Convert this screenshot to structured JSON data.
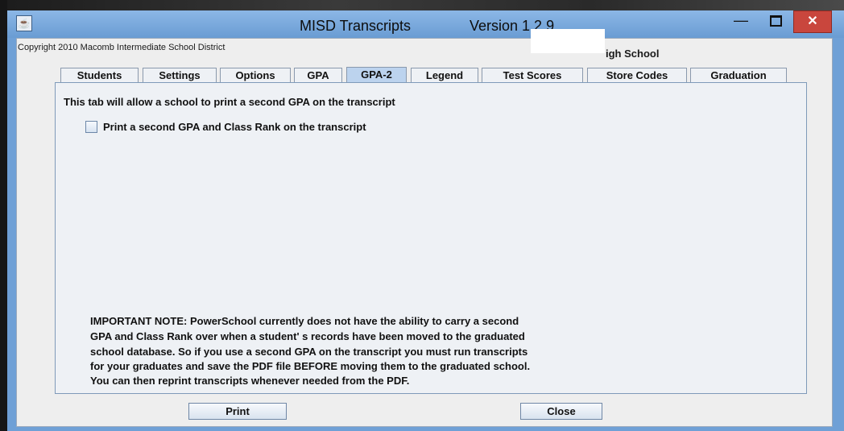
{
  "window": {
    "title": "MISD Transcripts",
    "version": "Version 1.2.9",
    "app_icon": "java-cup-icon",
    "controls": {
      "minimize": "—",
      "maximize": "maximize-icon",
      "close": "✕"
    }
  },
  "header": {
    "copyright": "Copyright 2010 Macomb Intermediate School District",
    "school_name": "igh School"
  },
  "tabs": [
    {
      "label": "Students"
    },
    {
      "label": "Settings"
    },
    {
      "label": "Options"
    },
    {
      "label": "GPA"
    },
    {
      "label": "GPA-2",
      "active": true
    },
    {
      "label": "Legend"
    },
    {
      "label": "Test Scores"
    },
    {
      "label": "Store Codes"
    },
    {
      "label": "Graduation"
    }
  ],
  "panel": {
    "intro": "This tab will allow a school to print a second GPA on the transcript",
    "checkbox": {
      "label": "Print a second GPA and Class Rank on the transcript",
      "checked": false
    },
    "note_lines": [
      "IMPORTANT NOTE:  PowerSchool currently does not have the ability to carry a second",
      "GPA and Class Rank over when a student' s records have been moved to the graduated",
      "school database.  So if you use a second GPA on the transcript you must run transcripts",
      "for your graduates and save the PDF file BEFORE moving them to the graduated school.",
      "You can then reprint transcripts whenever needed from the PDF."
    ]
  },
  "buttons": {
    "print": "Print",
    "close": "Close"
  }
}
